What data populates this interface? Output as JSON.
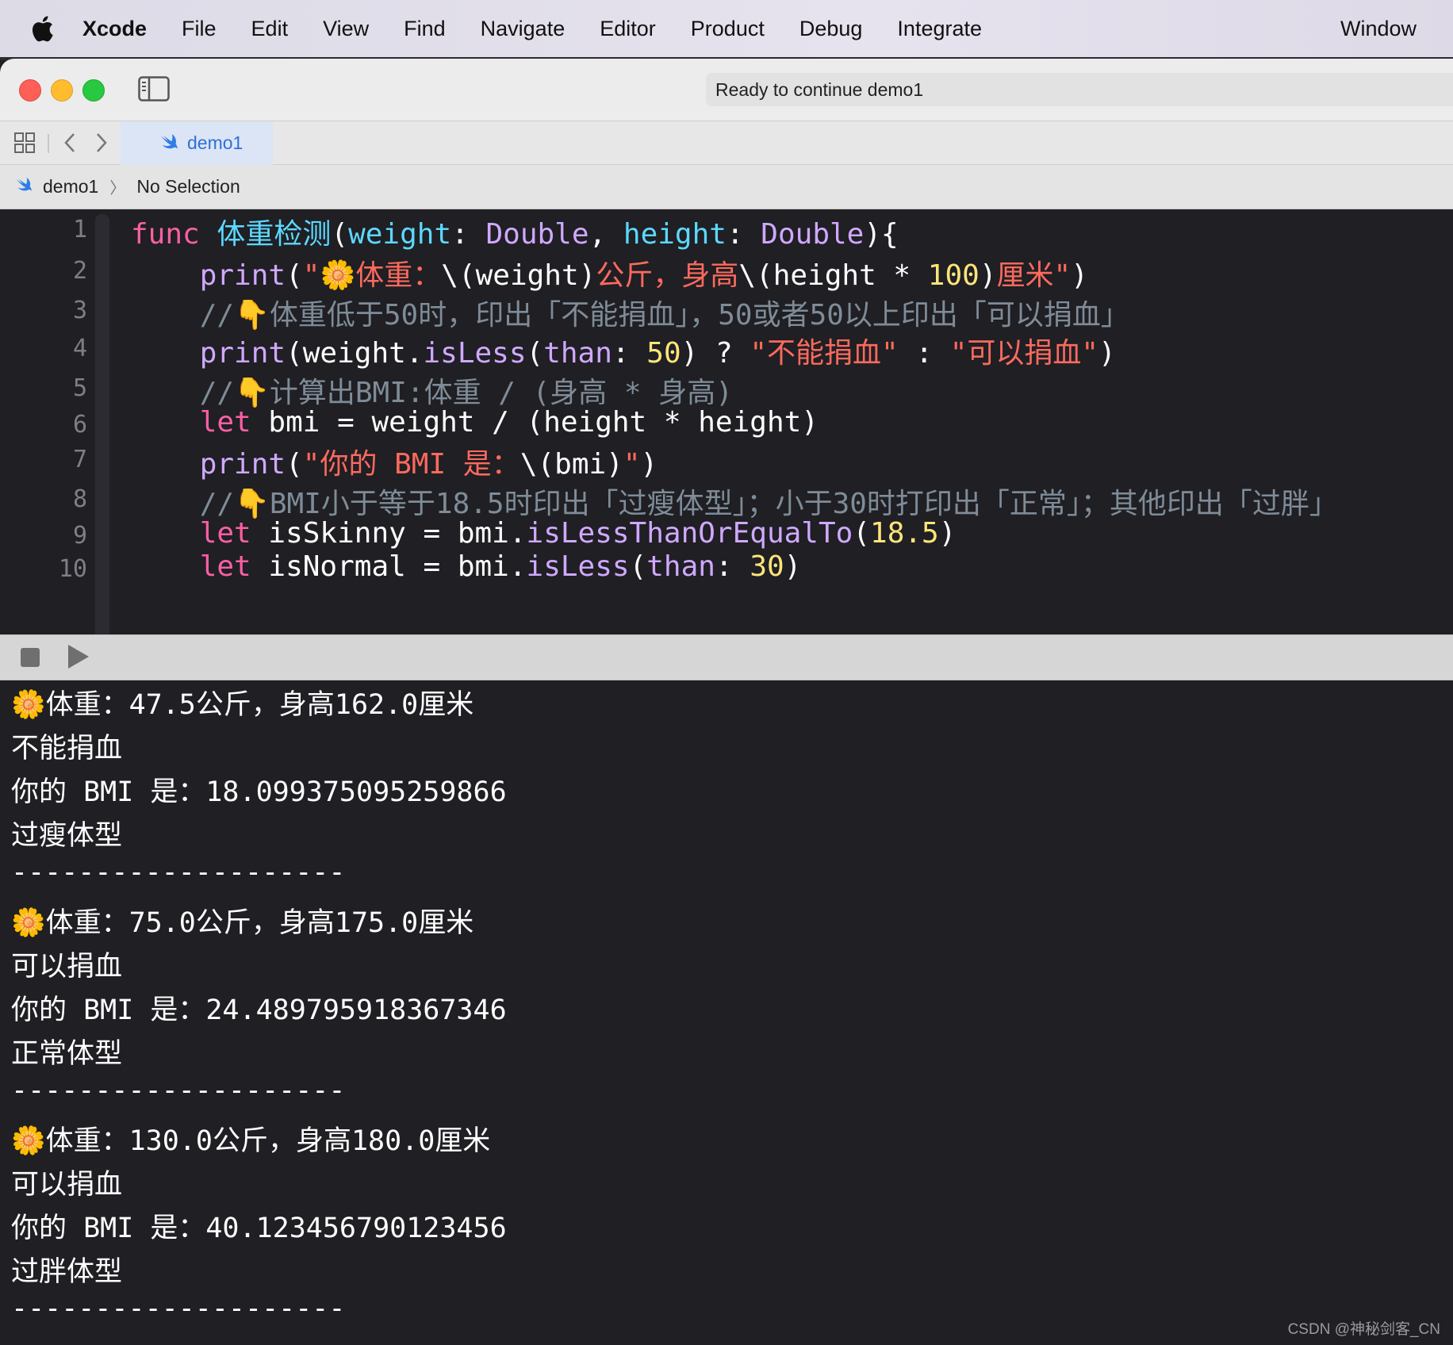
{
  "menubar": {
    "apple_icon": "apple-logo-icon",
    "app_name": "Xcode",
    "items": [
      "File",
      "Edit",
      "View",
      "Find",
      "Navigate",
      "Editor",
      "Product",
      "Debug",
      "Integrate"
    ],
    "window_label": "Window"
  },
  "toolbar": {
    "status": "Ready to continue demo1"
  },
  "tabs": [
    {
      "label": "demo1",
      "icon": "swift-icon",
      "active": true
    }
  ],
  "jumpbar": {
    "project": "demo1",
    "selection": "No Selection"
  },
  "editor": {
    "line_numbers": [
      "1",
      "2",
      "3",
      "4",
      "5",
      "6",
      "7",
      "8",
      "9",
      "10"
    ],
    "lines": [
      [
        {
          "t": "func ",
          "c": "kw"
        },
        {
          "t": "体重检测",
          "c": "fn"
        },
        {
          "t": "(",
          "c": "pl"
        },
        {
          "t": "weight",
          "c": "fn"
        },
        {
          "t": ": ",
          "c": "pl"
        },
        {
          "t": "Double",
          "c": "ty"
        },
        {
          "t": ", ",
          "c": "pl"
        },
        {
          "t": "height",
          "c": "fn"
        },
        {
          "t": ": ",
          "c": "pl"
        },
        {
          "t": "Double",
          "c": "ty"
        },
        {
          "t": "){",
          "c": "pl"
        }
      ],
      [
        {
          "t": "    ",
          "c": "pl"
        },
        {
          "t": "print",
          "c": "call"
        },
        {
          "t": "(",
          "c": "pl"
        },
        {
          "t": "\"🌼体重：",
          "c": "str"
        },
        {
          "t": "\\(weight)",
          "c": "pl"
        },
        {
          "t": "公斤，身高",
          "c": "str"
        },
        {
          "t": "\\(height * ",
          "c": "pl"
        },
        {
          "t": "100",
          "c": "num"
        },
        {
          "t": ")",
          "c": "pl"
        },
        {
          "t": "厘米\"",
          "c": "str"
        },
        {
          "t": ")",
          "c": "pl"
        }
      ],
      [
        {
          "t": "    //👇体重低于50时，印出「不能捐血」，50或者50以上印出「可以捐血」",
          "c": "cmt"
        }
      ],
      [
        {
          "t": "    ",
          "c": "pl"
        },
        {
          "t": "print",
          "c": "call"
        },
        {
          "t": "(weight.",
          "c": "pl"
        },
        {
          "t": "isLess",
          "c": "call"
        },
        {
          "t": "(",
          "c": "pl"
        },
        {
          "t": "than",
          "c": "call"
        },
        {
          "t": ": ",
          "c": "pl"
        },
        {
          "t": "50",
          "c": "num"
        },
        {
          "t": ") ? ",
          "c": "pl"
        },
        {
          "t": "\"不能捐血\"",
          "c": "str"
        },
        {
          "t": " : ",
          "c": "pl"
        },
        {
          "t": "\"可以捐血\"",
          "c": "str"
        },
        {
          "t": ")",
          "c": "pl"
        }
      ],
      [
        {
          "t": "    //👇计算出BMI:体重 / (身高 * 身高)",
          "c": "cmt"
        }
      ],
      [
        {
          "t": "    ",
          "c": "pl"
        },
        {
          "t": "let",
          "c": "kw"
        },
        {
          "t": " bmi = weight / (height * height)",
          "c": "pl"
        }
      ],
      [
        {
          "t": "    ",
          "c": "pl"
        },
        {
          "t": "print",
          "c": "call"
        },
        {
          "t": "(",
          "c": "pl"
        },
        {
          "t": "\"你的 BMI 是：",
          "c": "str"
        },
        {
          "t": "\\(bmi)",
          "c": "pl"
        },
        {
          "t": "\"",
          "c": "str"
        },
        {
          "t": ")",
          "c": "pl"
        }
      ],
      [
        {
          "t": "    //👇BMI小于等于18.5时印出「过瘦体型」；小于30时打印出「正常」；其他印出「过胖」",
          "c": "cmt"
        }
      ],
      [
        {
          "t": "    ",
          "c": "pl"
        },
        {
          "t": "let",
          "c": "kw"
        },
        {
          "t": " isSkinny = bmi.",
          "c": "pl"
        },
        {
          "t": "isLessThanOrEqualTo",
          "c": "call"
        },
        {
          "t": "(",
          "c": "pl"
        },
        {
          "t": "18.5",
          "c": "num"
        },
        {
          "t": ")",
          "c": "pl"
        }
      ],
      [
        {
          "t": "    ",
          "c": "pl"
        },
        {
          "t": "let",
          "c": "kw"
        },
        {
          "t": " isNormal = bmi.",
          "c": "pl"
        },
        {
          "t": "isLess",
          "c": "call"
        },
        {
          "t": "(",
          "c": "pl"
        },
        {
          "t": "than",
          "c": "call"
        },
        {
          "t": ": ",
          "c": "pl"
        },
        {
          "t": "30",
          "c": "num"
        },
        {
          "t": ")",
          "c": "pl"
        }
      ]
    ]
  },
  "debug": {
    "stop_icon": "stop-icon",
    "run_icon": "play-icon"
  },
  "console": {
    "lines": [
      "🌼体重：47.5公斤，身高162.0厘米",
      "不能捐血",
      "你的 BMI 是：18.099375095259866",
      "过瘦体型",
      "--------------------",
      "🌼体重：75.0公斤，身高175.0厘米",
      "可以捐血",
      "你的 BMI 是：24.489795918367346",
      "正常体型",
      "--------------------",
      "🌼体重：130.0公斤，身高180.0厘米",
      "可以捐血",
      "你的 BMI 是：40.123456790123456",
      "过胖体型",
      "--------------------"
    ]
  },
  "watermark": "CSDN @神秘剑客_CN",
  "colors": {
    "keyword": "#fc5fa3",
    "function_name": "#5dd8ff",
    "type": "#d0a8ff",
    "string": "#fc6a5d",
    "number": "#ffe57a",
    "comment": "#7f8c98",
    "editor_bg": "#1f1f24"
  }
}
